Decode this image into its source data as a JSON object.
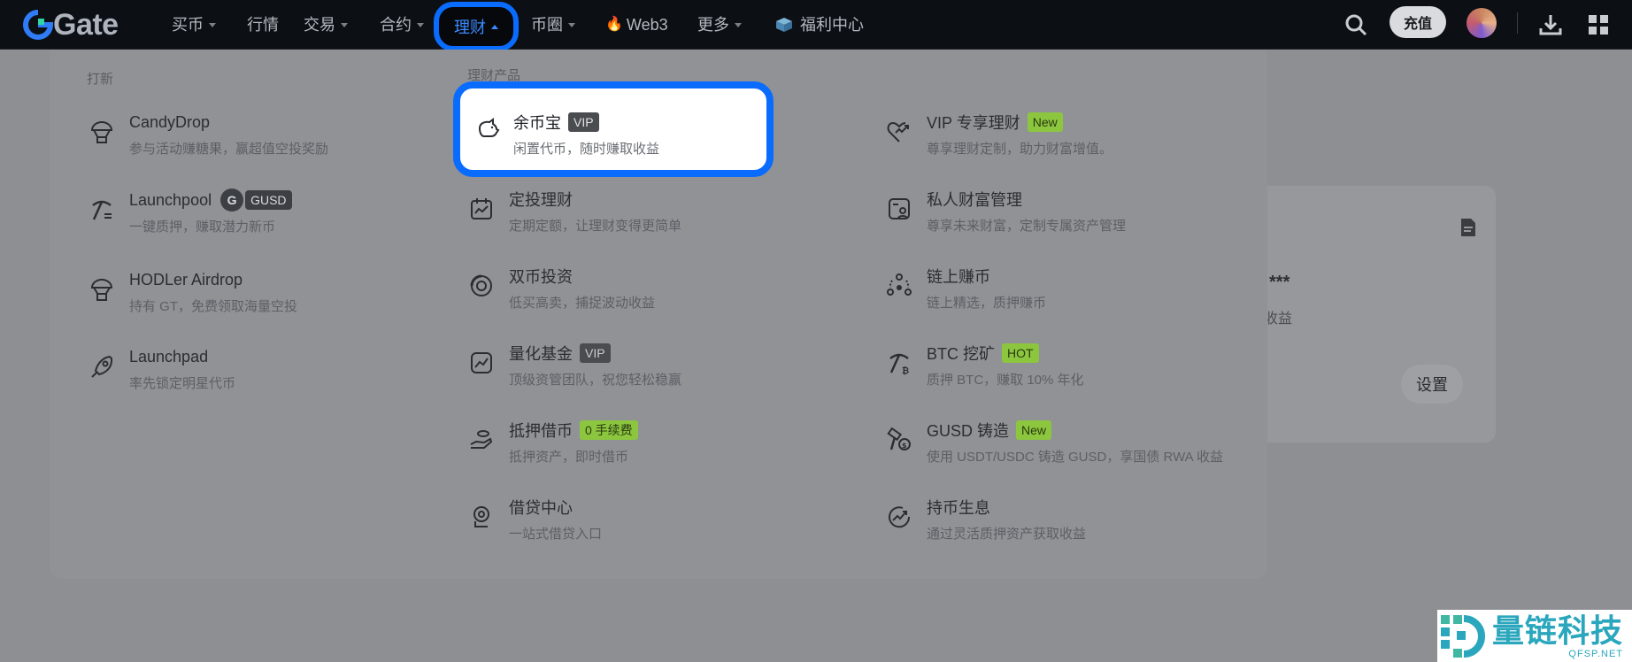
{
  "nav": {
    "logo_text": "Gate",
    "items": [
      {
        "label": "买币",
        "caret": true
      },
      {
        "label": "行情",
        "caret": false
      },
      {
        "label": "交易",
        "caret": true
      },
      {
        "label": "合约",
        "caret": true
      },
      {
        "label": "理财",
        "caret": true,
        "active": true
      },
      {
        "label": "币圈",
        "caret": true
      },
      {
        "label": "Web3",
        "caret": false
      },
      {
        "label": "更多",
        "caret": true
      },
      {
        "label": "福利中心",
        "caret": false
      }
    ],
    "topup_label": "充值"
  },
  "dropdown": {
    "launch_section_title": "打新",
    "products_section_title": "理财产品",
    "launch_items": [
      {
        "name": "CandyDrop",
        "desc": "参与活动赚糖果，赢超值空投奖励"
      },
      {
        "name": "Launchpool",
        "badge": "GUSD",
        "desc": "一键质押，赚取潜力新币"
      },
      {
        "name": "HODLer Airdrop",
        "desc": "持有 GT，免费领取海量空投"
      },
      {
        "name": "Launchpad",
        "desc": "率先锁定明星代币"
      }
    ],
    "highlighted": {
      "name": "余币宝",
      "badge": "VIP",
      "desc": "闲置代币，随时赚取收益"
    },
    "middle_items": [
      {
        "name": "定投理财",
        "desc": "定期定额，让理财变得更简单"
      },
      {
        "name": "双币投资",
        "desc": "低买高卖，捕捉波动收益"
      },
      {
        "name": "量化基金",
        "badge": "VIP",
        "desc": "顶级资管团队，祝您轻松稳赢"
      },
      {
        "name": "抵押借币",
        "badge": "0 手续费",
        "desc": "抵押资产，即时借币"
      },
      {
        "name": "借贷中心",
        "desc": "一站式借贷入口"
      }
    ],
    "right_items": [
      {
        "name": "VIP 专享理财",
        "badge": "New",
        "desc": "尊享理财定制，助力财富增值。"
      },
      {
        "name": "私人财富管理",
        "desc": "尊享未来财富，定制专属资产管理"
      },
      {
        "name": "链上赚币",
        "desc": "链上精选，质押赚币"
      },
      {
        "name": "BTC 挖矿",
        "badge": "HOT",
        "desc": "质押 BTC，赚取 10% 年化"
      },
      {
        "name": "GUSD 铸造",
        "badge": "New",
        "desc": "使用 USDT/USDC 铸造 GUSD，享国债 RWA 收益"
      },
      {
        "name": "持币生息",
        "desc": "通过灵活质押资产获取收益"
      }
    ]
  },
  "background": {
    "masked_value": "***",
    "income_label": "收益",
    "settings_label": "设置"
  },
  "watermark": {
    "cn": "量链科技",
    "en": "QFSP.NET"
  },
  "colors": {
    "accent": "#0a6cff",
    "nav_bg": "#0c0f14",
    "badge_green": "#8cc63f"
  }
}
